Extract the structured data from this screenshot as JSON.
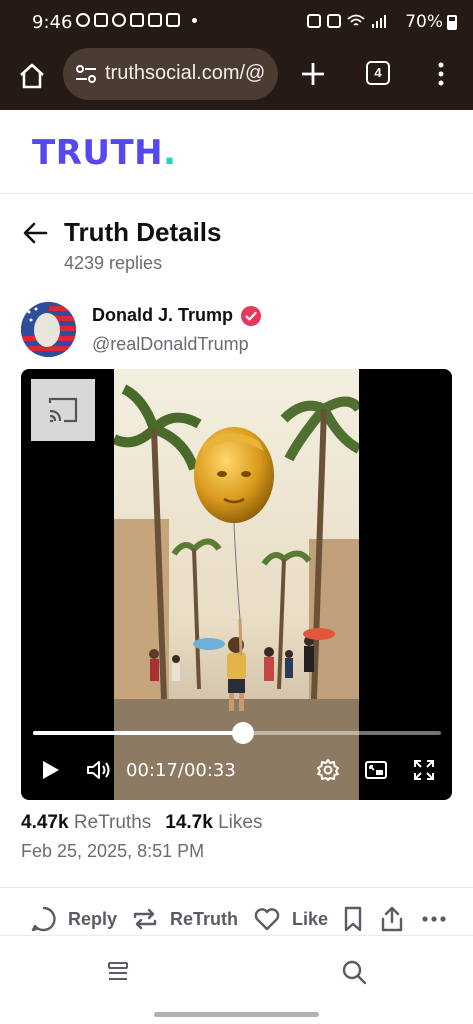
{
  "status_bar": {
    "time": "9:46",
    "battery": "70%",
    "notification_icons": [
      "messenger-icon",
      "gmail-icon",
      "chrome-icon",
      "app-icon",
      "calendar-icon",
      "photos-icon"
    ],
    "system_icons": [
      "alarm-icon",
      "wifi-icon",
      "signal-icon"
    ]
  },
  "browser": {
    "url": "truthsocial.com/@",
    "tab_count": "4"
  },
  "site": {
    "logo": "TRUTH",
    "logo_dot": ".",
    "brand_color": "#5448ee",
    "accent_color": "#1ed4c4"
  },
  "page": {
    "title": "Truth Details",
    "replies": "4239 replies"
  },
  "post": {
    "author_name": "Donald J. Trump",
    "handle": "@realDonaldTrump",
    "verified_color": "#e8365d",
    "video": {
      "time_current": "00:17",
      "time_separator": "/",
      "time_total": "00:33",
      "progress": 0.5152
    },
    "retruths_count": "4.47k",
    "retruths_label": "ReTruths",
    "likes_count": "14.7k",
    "likes_label": "Likes",
    "date": "Feb 25, 2025, 8:51 PM"
  },
  "actions": {
    "reply": "Reply",
    "retruth": "ReTruth",
    "like": "Like"
  }
}
